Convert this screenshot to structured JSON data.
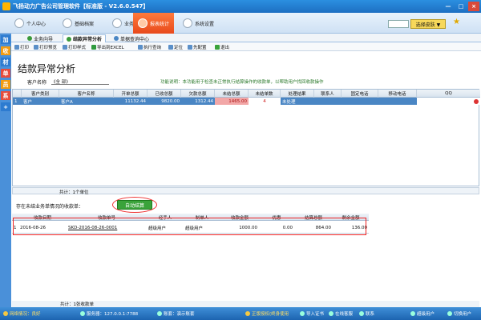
{
  "window": {
    "title": "飞扬动力广告公司管理软件【标准版 - V2.6.0.547】",
    "minimize": "—",
    "maximize": "□",
    "close": "×"
  },
  "menu": [
    {
      "label": "个人中心",
      "icon": "user-icon"
    },
    {
      "label": "基础档案",
      "icon": "archive-icon"
    },
    {
      "label": "业务处理",
      "icon": "business-icon"
    },
    {
      "label": "报表统计",
      "icon": "report-icon",
      "active": true
    },
    {
      "label": "系统设置",
      "icon": "settings-icon"
    }
  ],
  "skin": {
    "button": "选择皮肤 ▼",
    "icon": "★"
  },
  "left_strip": [
    "加",
    "收",
    "材",
    "单",
    "员",
    "系",
    "+"
  ],
  "tabs": [
    {
      "label": "业务向导"
    },
    {
      "label": "结款异常分析",
      "active": true
    },
    {
      "label": "单据查询中心"
    }
  ],
  "toolbar": [
    "打印",
    "打印预览",
    "打印样式",
    "导出到EXCEL",
    "执行查询",
    "定位",
    "先配置",
    "退出"
  ],
  "page_title": "结款异常分析",
  "filter": {
    "label": "客户名称",
    "value": "《全 部》"
  },
  "func_note": "功能说明：本功能用于检查未正常执行结算操作的收款单，以帮助用户找回收款操作",
  "grid1": {
    "headers": [
      "",
      "客户类别",
      "客户名称",
      "开单总额",
      "已收总额",
      "欠款总额",
      "未结总额",
      "未结单数",
      "处理结果",
      "联系人",
      "固定电话",
      "移动电话",
      "QQ"
    ],
    "row": [
      "1",
      "客户",
      "客户A",
      "11132.44",
      "9820.00",
      "1312.44",
      "1465.00",
      "4",
      "未处理",
      "",
      "",
      "",
      ""
    ],
    "footer": "共计：1个单位"
  },
  "sub_label": "存在未结业务单情况的收款单：",
  "auto_button": "自动结算",
  "grid2": {
    "headers": [
      "",
      "收款日期",
      "收款单号",
      "经手人",
      "制单人",
      "收款金额",
      "优惠",
      "结算总额",
      "剩余金额"
    ],
    "row": [
      "1",
      "2016-08-26",
      "SKD-2016-08-26-0001",
      "超级用户",
      "超级用户",
      "1000.00",
      "0.00",
      "864.00",
      "136.00"
    ],
    "footer": "共计：1张收款单"
  },
  "statusbar": {
    "network": "网络情况：良好",
    "server": "服务器：127.0.0.1:7788",
    "account": "账套：演示账套",
    "license": "正版授权(终身使用",
    "import_cert": "导入证书",
    "online_service": "在线客服",
    "contact": "联系",
    "user": "超级用户",
    "switch_user": "切换用户"
  }
}
